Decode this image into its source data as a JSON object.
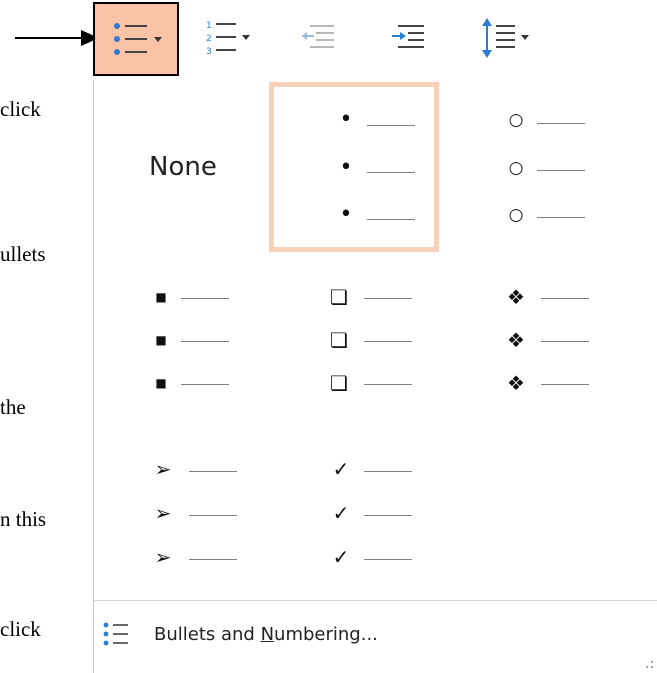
{
  "document_text": [
    "click",
    "ullets",
    "the",
    "n this",
    "click"
  ],
  "ribbon": {
    "buttons": [
      {
        "name": "bullets-button",
        "icon": "bullet-list-icon",
        "dropdown": true
      },
      {
        "name": "numbering-button",
        "icon": "numbered-list-icon",
        "dropdown": true
      },
      {
        "name": "decrease-indent-button",
        "icon": "decrease-indent-icon",
        "dropdown": false
      },
      {
        "name": "increase-indent-button",
        "icon": "increase-indent-icon",
        "dropdown": false
      },
      {
        "name": "line-spacing-button",
        "icon": "line-spacing-icon",
        "dropdown": true
      }
    ]
  },
  "bullet_library": {
    "none_label": "None",
    "styles": [
      {
        "name": "none"
      },
      {
        "name": "filled-round-bullet",
        "symbol": "•",
        "selected": true
      },
      {
        "name": "hollow-round-bullet",
        "symbol": "○"
      },
      {
        "name": "filled-square-bullet",
        "symbol": "■"
      },
      {
        "name": "hollow-square-bullet",
        "symbol": "❏"
      },
      {
        "name": "star-bullet",
        "symbol": "❖"
      },
      {
        "name": "arrow-bullet",
        "symbol": "➢"
      },
      {
        "name": "checkmark-bullet",
        "symbol": "✓"
      }
    ]
  },
  "footer": {
    "label_before": "Bullets and ",
    "label_underlined": "N",
    "label_after": "umbering..."
  },
  "colors": {
    "selected_fill": "#f9c3a8",
    "selected_border": "#fbd0b9",
    "icon_blue": "#2b7cd3"
  }
}
